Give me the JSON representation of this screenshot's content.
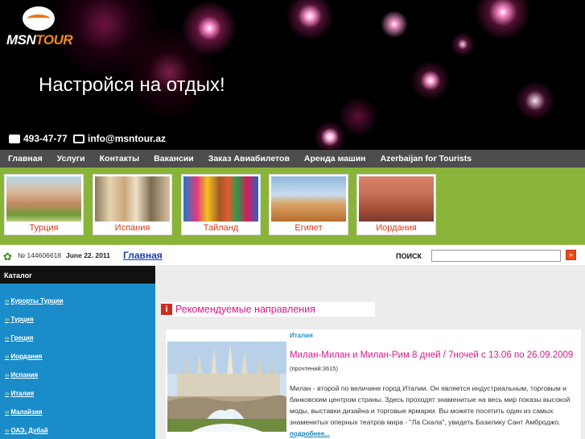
{
  "header": {
    "logo_left": "MSN",
    "logo_right": "TOUR",
    "slogan": "Настройся на отдых!",
    "phone": "493-47-77",
    "email": "info@msntour.az"
  },
  "nav": {
    "items": [
      "Главная",
      "Услуги",
      "Контакты",
      "Вакансии",
      "Заказ Авиабилетов",
      "Аренда машин",
      "Azerbaijan for Tourists"
    ]
  },
  "destinations": [
    "Турция",
    "Испания",
    "Тайланд",
    "Египет",
    "Иордания"
  ],
  "infobar": {
    "counter": "№ 144606618",
    "date": "June 22. 2011",
    "home_link": "Главная",
    "search_label": "ПОИСК",
    "search_value": ""
  },
  "sidebar": {
    "title": "Каталог",
    "items": [
      "Курорты Турции",
      "Турция",
      "Греция",
      "Иордания",
      "Испания",
      "Италия",
      "Малайзия",
      "ОАЭ, Дубай"
    ]
  },
  "recommended": {
    "heading": "Рекомендуемые направления",
    "category": "Италия",
    "title": "Милан-Милан и Милан-Рим 8 дней / 7ночей с 13.06 по 26.09.2009",
    "reads": "(прочтений:3615)",
    "description": "Милан - второй по величине город Италии. Он является индустриальным, торговым и банковским центром страны. Здесь проходят знаменитые на весь мир показы высокой моды, выставки дизайна и торговые ярмарки. Вы можете посетить один из самых знаменитых оперных театров мира - \"Ла Скала\", увидеть Базилику Сант Амброджо.",
    "more": "подробнее..."
  },
  "colors": {
    "nav_bg": "#4d4d4d",
    "band_green": "#8ab33a",
    "sidebar_blue": "#1a8cc9",
    "accent_magenta": "#d41c8f",
    "dest_label": "#d43a1a"
  }
}
